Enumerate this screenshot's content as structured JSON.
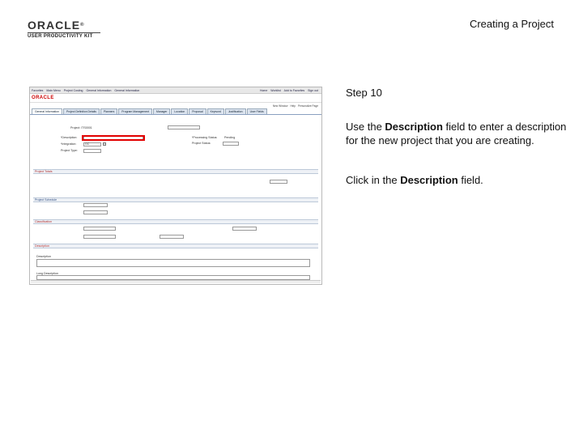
{
  "header": {
    "logo_brand": "ORACLE",
    "logo_reg": "®",
    "logo_sub": "USER PRODUCTIVITY KIT",
    "doc_title": "Creating a Project"
  },
  "step": {
    "title": "Step 10",
    "desc_part1": "Use the ",
    "desc_bold": "Description",
    "desc_part2": " field to enter a description for the new project that you are creating.",
    "click_part1": "Click in the ",
    "click_bold": "Description",
    "click_part2": " field."
  },
  "app": {
    "nav_items": [
      "Favorites",
      "Main Menu",
      "Project Costing",
      "General Information",
      "General Information"
    ],
    "nav_right": [
      "Home",
      "Worklist",
      "Add to Favorites",
      "Sign out"
    ],
    "brand": "ORACLE",
    "util_links": [
      "New Window",
      "Help",
      "Personalize Page"
    ],
    "tabs": [
      "General Information",
      "Project Definition Details",
      "Planners",
      "Program Management",
      "Manager",
      "Location",
      "Proposal",
      "Keyword",
      "Justification",
      "User Fields"
    ],
    "project_label": "Project: ITS0001",
    "description_label": "*Description:",
    "integration_label": "*Integration:",
    "integration_value": "GC",
    "project_type_label": "Project Type:",
    "processing_status_label": "*Processing Status:",
    "processing_status_value": "Pending",
    "project_status_label": "Project Status:",
    "section_project": "Project Totals",
    "section_schedule": "Project Schedule",
    "section_classification": "Classification",
    "section_description": "Description",
    "description_field_label": "Description",
    "long_desc_label": "Long Description"
  }
}
